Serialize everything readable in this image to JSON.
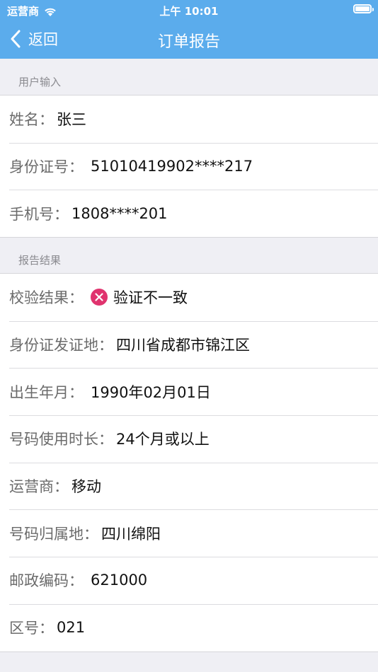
{
  "status_bar": {
    "carrier": "运营商",
    "time": "上午 10:01"
  },
  "nav": {
    "back_label": "返回",
    "title": "订单报告"
  },
  "sections": {
    "user_input": {
      "header": "用户输入",
      "rows": [
        {
          "label": "姓名：",
          "value": "张三"
        },
        {
          "label": "身份证号：",
          "value": "51010419902****217"
        },
        {
          "label": "手机号：",
          "value": "1808****201"
        }
      ]
    },
    "report": {
      "header": "报告结果",
      "rows": [
        {
          "label": "校验结果：",
          "value": "验证不一致",
          "icon": "error-x-icon"
        },
        {
          "label": "身份证发证地：",
          "value": "四川省成都市锦江区"
        },
        {
          "label": "出生年月：",
          "value": "1990年02月01日"
        },
        {
          "label": "号码使用时长：",
          "value": "24个月或以上"
        },
        {
          "label": "运营商：",
          "value": "移动"
        },
        {
          "label": "号码归属地：",
          "value": "四川绵阳"
        },
        {
          "label": "邮政编码：",
          "value": "621000"
        },
        {
          "label": "区号：",
          "value": "021"
        }
      ]
    }
  },
  "colors": {
    "nav_bg": "#5bacec",
    "error": "#e0336e"
  }
}
